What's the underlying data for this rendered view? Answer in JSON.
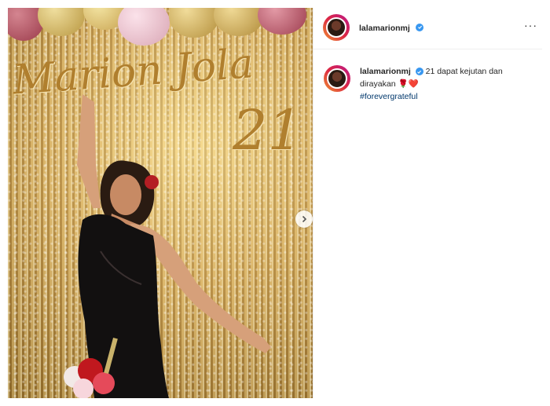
{
  "post": {
    "photo_overlay_title": "Marion Jola",
    "photo_overlay_number": "21"
  },
  "header": {
    "username": "lalamarionmj",
    "more_label": "···"
  },
  "caption": {
    "username": "lalamarionmj",
    "text": "21 dapat kejutan dan dirayakan",
    "emoji": "🌹❤️",
    "hashtag": "#forevergrateful"
  },
  "colors": {
    "verified": "#3897f0",
    "hashtag": "#00376b",
    "text": "#262626"
  }
}
